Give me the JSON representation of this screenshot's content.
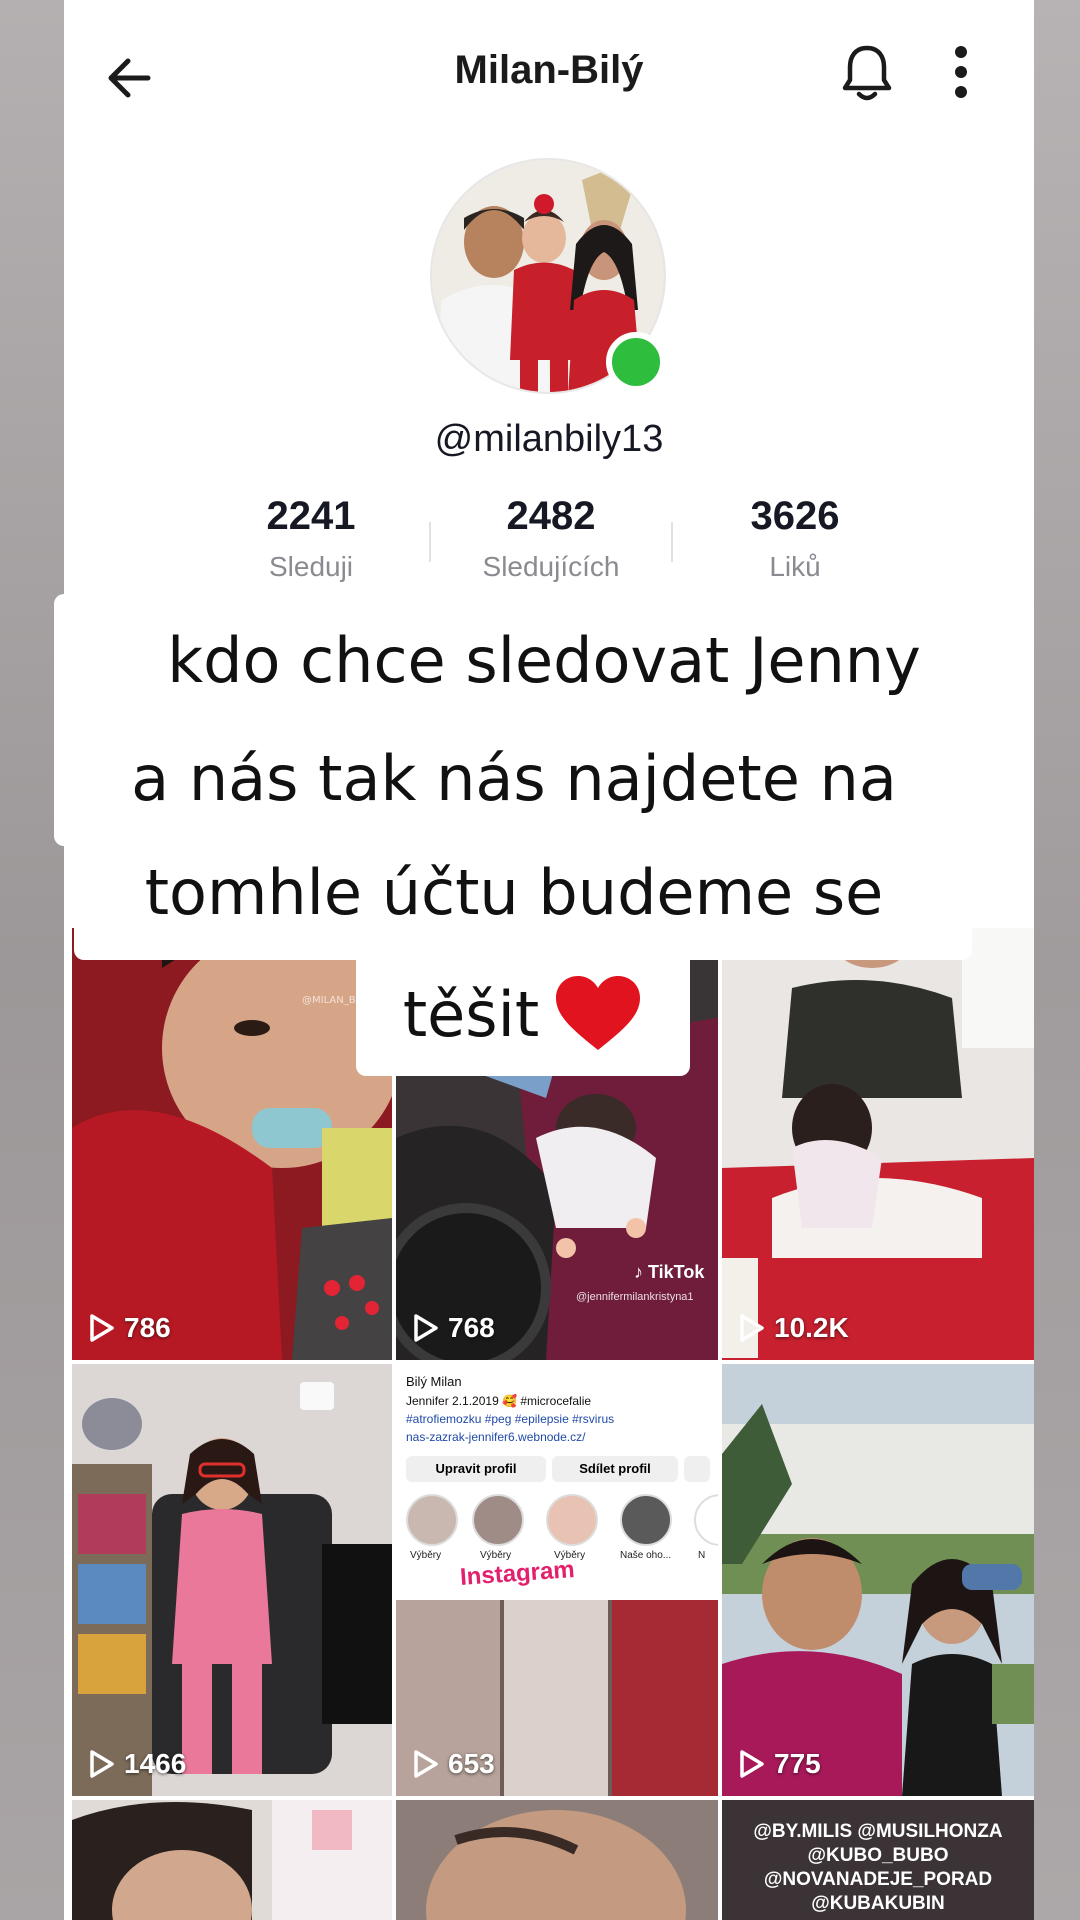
{
  "header": {
    "title": "Milan-Bilý"
  },
  "profile": {
    "username": "@milanbily13",
    "stats": [
      {
        "value": "2241",
        "label": "Sleduji"
      },
      {
        "value": "2482",
        "label": "Sledujících"
      },
      {
        "value": "3626",
        "label": "Liků"
      }
    ]
  },
  "caption": {
    "lines": [
      "kdo chce sledovat Jenny",
      "a nás tak nás najdete na",
      "tomhle účtu budeme se",
      "těšit"
    ]
  },
  "videos": [
    {
      "views": "786",
      "watermark": "@MILAN_BIL"
    },
    {
      "views": "768",
      "brand": "TikTok",
      "handle": "@jennifermilankristyna1"
    },
    {
      "views": "10.2K"
    },
    {
      "views": "1466"
    },
    {
      "views": "653",
      "inner": {
        "name": "Bilý Milan",
        "bio_line1": "Jennifer 2.1.2019 🥰 #microcefalie",
        "bio_line2": "#atrofiemozku  #peg #epilepsie #rsvirus",
        "link": "nas-zazrak-jennifer6.webnode.cz/",
        "edit_button": "Upravit profil",
        "share_button": "Sdílet profil",
        "highlights": [
          "Výběry",
          "Výběry",
          "Výběry",
          "Naše oho...",
          "N"
        ],
        "sticker": "Instagram"
      }
    },
    {
      "views": "775"
    },
    {},
    {},
    {
      "mentions": [
        "@BY.MILIS @MUSILHONZA",
        "@KUBO_BUBO",
        "@NOVANADEJE_PORAD",
        "@KUBAKUBIN"
      ]
    }
  ],
  "colors": {
    "online": "#2fbd3e",
    "heart": "#e0131e",
    "text": "#161823",
    "muted": "#8a8b91"
  },
  "icons": [
    "back-arrow-icon",
    "bell-icon",
    "more-vertical-icon",
    "play-icon",
    "heart-icon",
    "image-icon"
  ]
}
